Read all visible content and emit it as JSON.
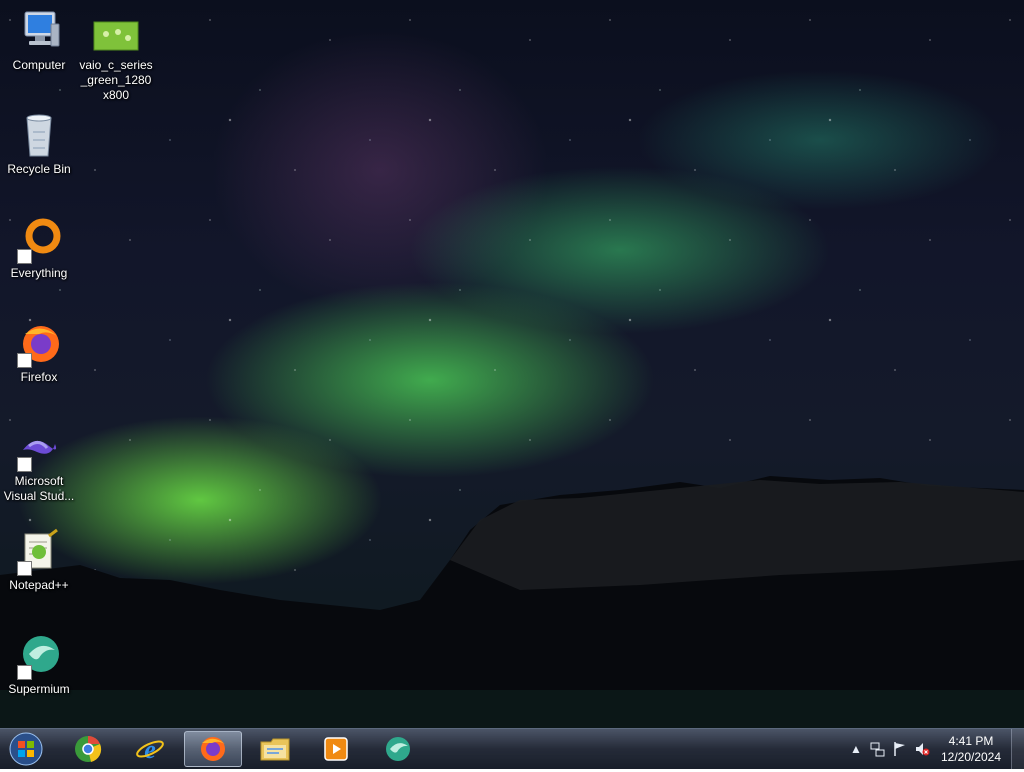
{
  "desktop": {
    "icons": [
      {
        "label": "Computer",
        "icon": "computer-icon",
        "shortcut": false
      },
      {
        "label": "vaio_c_series_green_1280x800",
        "icon": "image-file-icon",
        "shortcut": false
      },
      {
        "label": "Recycle Bin",
        "icon": "recycle-bin-icon",
        "shortcut": false
      },
      {
        "label": "Everything",
        "icon": "everything-search-icon",
        "shortcut": true
      },
      {
        "label": "Firefox",
        "icon": "firefox-icon",
        "shortcut": true
      },
      {
        "label": "Microsoft Visual Stud...",
        "icon": "visual-studio-icon",
        "shortcut": true
      },
      {
        "label": "Notepad++",
        "icon": "notepadpp-icon",
        "shortcut": true
      },
      {
        "label": "Supermium",
        "icon": "supermium-icon",
        "shortcut": true
      }
    ]
  },
  "taskbar": {
    "start_icon": "windows-start-icon",
    "pinned": [
      {
        "name": "chrome-style-browser",
        "icon": "chrome-icon",
        "active": false
      },
      {
        "name": "internet-explorer",
        "icon": "ie-icon",
        "active": false
      },
      {
        "name": "firefox",
        "icon": "firefox-icon",
        "active": true
      },
      {
        "name": "file-explorer",
        "icon": "folder-icon",
        "active": false
      },
      {
        "name": "media-player",
        "icon": "media-player-icon",
        "active": false
      },
      {
        "name": "supermium",
        "icon": "supermium-icon",
        "active": false
      }
    ],
    "tray": {
      "icons": [
        "show-hidden-icons-icon",
        "network-icon",
        "action-center-flag-icon",
        "volume-muted-icon"
      ],
      "time": "4:41 PM",
      "date": "12/20/2024"
    }
  }
}
